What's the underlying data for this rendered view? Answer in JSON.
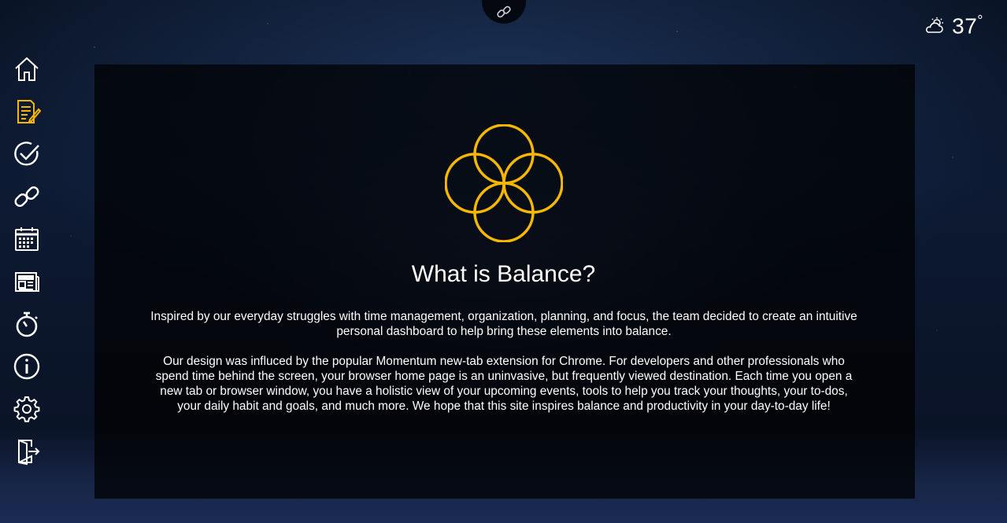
{
  "colors": {
    "accent": "#f5b800",
    "icon": "#ffffff"
  },
  "sidebar": {
    "items": [
      {
        "label": "Home",
        "icon": "home-icon",
        "active": false
      },
      {
        "label": "Notes",
        "icon": "notes-icon",
        "active": true
      },
      {
        "label": "To-Do",
        "icon": "check-circle-icon",
        "active": false
      },
      {
        "label": "Balance",
        "icon": "infinity-link-icon",
        "active": false
      },
      {
        "label": "Calendar",
        "icon": "calendar-icon",
        "active": false
      },
      {
        "label": "News",
        "icon": "newspaper-icon",
        "active": false
      },
      {
        "label": "Timer",
        "icon": "stopwatch-icon",
        "active": false
      },
      {
        "label": "About",
        "icon": "info-icon",
        "active": false
      },
      {
        "label": "Settings",
        "icon": "gear-icon",
        "active": false
      },
      {
        "label": "Logout",
        "icon": "exit-door-icon",
        "active": false
      }
    ]
  },
  "top_link": {
    "icon": "link-icon"
  },
  "weather": {
    "icon": "partly-cloudy-icon",
    "temperature": "37",
    "unit": "°"
  },
  "about": {
    "title": "What is Balance?",
    "paragraph1": "Inspired by our everyday struggles with time management, organization, planning, and focus, the team decided to create an intuitive personal dashboard to help bring these elements into balance.",
    "paragraph2": "Our design was influced by the popular Momentum new-tab extension for Chrome. For developers and other professionals who spend time behind the screen, your browser home page is an uninvasive, but frequently viewed destination. Each time you open a new tab or browser window, you have a holistic view of your upcoming events, tools to help you track your thoughts, your to-dos, your daily habit and goals, and much more. We hope that this site inspires balance and productivity in your day-to-day life!"
  }
}
